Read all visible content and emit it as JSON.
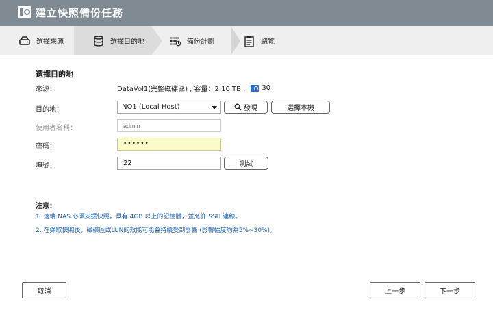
{
  "window": {
    "title": "建立快照備份任務",
    "logo_icon": "qnap-snapshot-logo-icon"
  },
  "steps": [
    {
      "label": "選擇來源",
      "icon": "drive-icon"
    },
    {
      "label": "選擇目的地",
      "icon": "database-icon",
      "active": true
    },
    {
      "label": "備份計劃",
      "icon": "schedule-list-icon"
    },
    {
      "label": "總覽",
      "icon": "clipboard-icon"
    }
  ],
  "form": {
    "title": "選擇目的地",
    "source_label": "來源：",
    "source_value": "DataVol1(完整磁碟區) , 容量：2.10 TB ,",
    "source_snapshot_count": "30",
    "destination_label": "目的地：",
    "destination_selected": "NO1 (Local Host)",
    "discover_button": "發現",
    "select_local_button": "選擇本機",
    "username_label": "使用者名稱：",
    "username_placeholder": "admin",
    "password_label": "密碼：",
    "password_value": "••••••",
    "port_label": "埠號：",
    "port_value": "22",
    "test_button": "測試"
  },
  "notes": {
    "title": "注意：",
    "items": [
      "1. 遠端 NAS 必須支援快照，具有 4GB 以上的記憶體，並允許 SSH 連線。",
      "2. 在擷取快照後，磁碟區或LUN的效能可能會持續受到影響 (影響幅度約為5%~30%)。"
    ]
  },
  "footer": {
    "cancel": "取消",
    "previous": "上一步",
    "next": "下一步"
  },
  "colors": {
    "titlebar": "#7f8a93",
    "note_text": "#1a5fb4",
    "password_bg": "#fbfbc9"
  }
}
